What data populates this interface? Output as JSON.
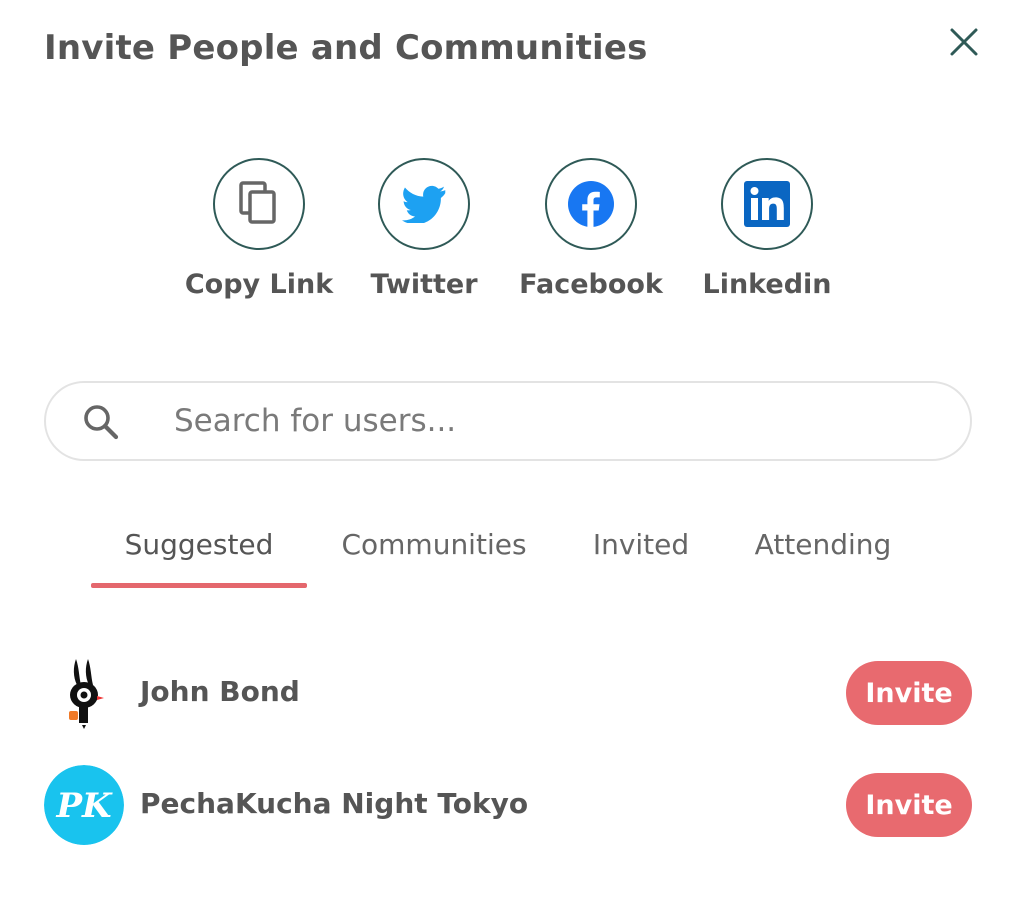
{
  "dialog": {
    "title": "Invite People and Communities",
    "close_icon": "close-icon"
  },
  "share": {
    "items": [
      {
        "label": "Copy Link",
        "icon": "copy-icon"
      },
      {
        "label": "Twitter",
        "icon": "twitter-icon"
      },
      {
        "label": "Facebook",
        "icon": "facebook-icon"
      },
      {
        "label": "Linkedin",
        "icon": "linkedin-icon"
      }
    ]
  },
  "search": {
    "placeholder": "Search for users...",
    "value": "",
    "icon": "search-icon"
  },
  "tabs": {
    "items": [
      {
        "label": "Suggested",
        "active": true
      },
      {
        "label": "Communities",
        "active": false
      },
      {
        "label": "Invited",
        "active": false
      },
      {
        "label": "Attending",
        "active": false
      }
    ]
  },
  "users": [
    {
      "name": "John Bond",
      "action": "Invite"
    },
    {
      "name": "PechaKucha Night Tokyo",
      "action": "Invite",
      "avatar_text": "PK"
    }
  ],
  "colors": {
    "accent": "#e86a6f",
    "circle_border": "#2f5a57",
    "twitter": "#1da1f2",
    "facebook": "#1877f2",
    "linkedin": "#0a66c2",
    "pk_avatar": "#19c3ee",
    "text": "#555555"
  }
}
